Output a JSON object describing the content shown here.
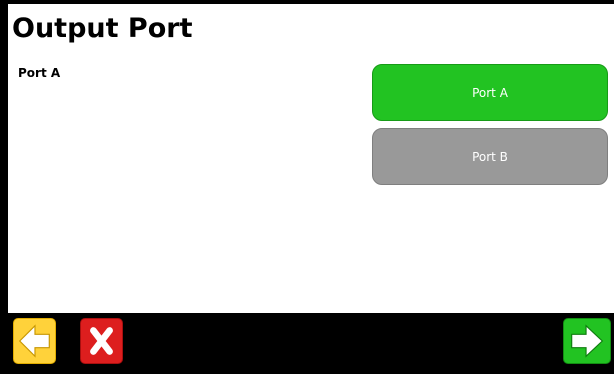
{
  "header": {
    "title": "Output Port"
  },
  "status": {
    "current_port": "Port A"
  },
  "options": [
    {
      "label": "Port A",
      "selected": true
    },
    {
      "label": "Port B",
      "selected": false
    }
  ],
  "bottom_bar": {
    "back_icon": "arrow-left-icon",
    "cancel_icon": "close-icon",
    "next_icon": "arrow-right-icon"
  },
  "colors": {
    "selected": "#22c322",
    "unselected": "#999999",
    "back": "#ffd23a",
    "cancel": "#dd1e1e",
    "next": "#22c322"
  }
}
